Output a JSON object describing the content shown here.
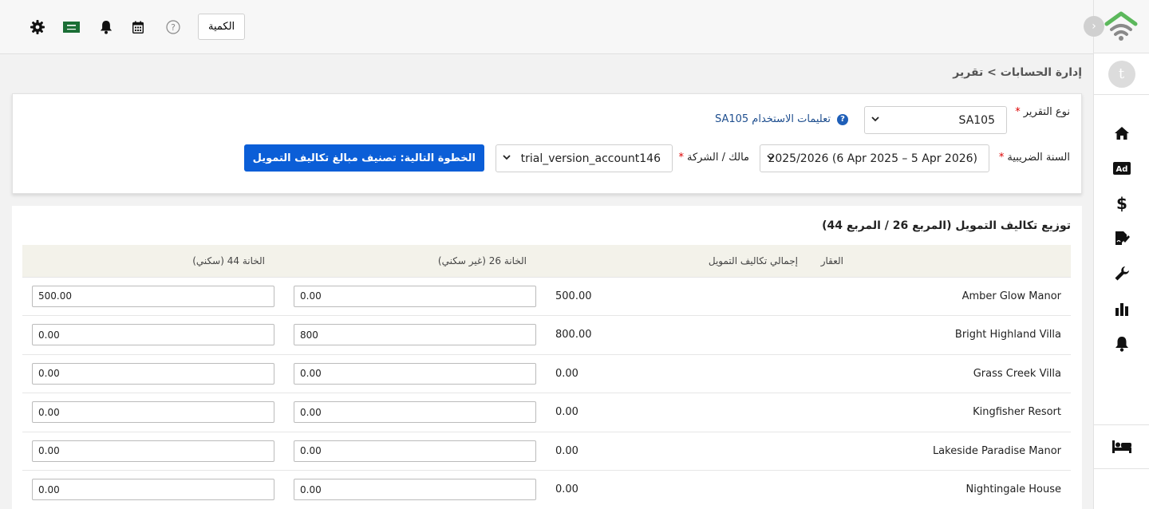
{
  "topbar": {
    "quantity_button": "الكمية",
    "icons": [
      "settings-gear-icon",
      "saudi-flag-icon",
      "bell-icon",
      "calendar-icon",
      "help-circle-icon"
    ]
  },
  "sidebar": {
    "avatar_letter": "t",
    "nav_icons": [
      "home-icon",
      "ad-icon",
      "dollar-icon",
      "signature-icon",
      "wrench-icon",
      "bar-chart-icon",
      "bell-icon"
    ],
    "bottom_icon": "bed-icon"
  },
  "breadcrumb": "إدارة الحسابات > تقرير",
  "filters": {
    "report_type_label": "نوع التقرير",
    "report_type_value": "SA105",
    "help_link": "تعليمات الاستخدام SA105",
    "tax_year_label": "السنة الضريبية",
    "tax_year_value": "2025/2026 (6 Apr 2025 – 5 Apr 2026)",
    "owner_label": "مالك / الشركة",
    "owner_value": "trial_version_account146",
    "next_button": "الخطوة التالية: تصنيف مبالغ تكاليف التمويل",
    "required_mark": "*"
  },
  "table": {
    "title": "توزيع تكاليف التمويل (المربع 26 / المربع 44)",
    "headers": {
      "property": "العقار",
      "total": "إجمالي تكاليف التمويل",
      "box26": "الخانة 26 (غير سكني)",
      "box44": "الخانة 44 (سكني)"
    },
    "rows": [
      {
        "property": "Amber Glow Manor",
        "total": "500.00",
        "box26": "0.00",
        "box44": "500.00"
      },
      {
        "property": "Bright Highland Villa",
        "total": "800.00",
        "box26": "800",
        "box44": "0.00"
      },
      {
        "property": "Grass Creek Villa",
        "total": "0.00",
        "box26": "0.00",
        "box44": "0.00"
      },
      {
        "property": "Kingfisher Resort",
        "total": "0.00",
        "box26": "0.00",
        "box44": "0.00"
      },
      {
        "property": "Lakeside Paradise Manor",
        "total": "0.00",
        "box26": "0.00",
        "box44": "0.00"
      },
      {
        "property": "Nightingale House",
        "total": "0.00",
        "box26": "0.00",
        "box44": "0.00"
      }
    ]
  },
  "colors": {
    "primary": "#0b5ed7",
    "logo_green": "#5cb85c",
    "logo_gray": "#8a8a8a",
    "header_bg": "#f3f2ea"
  }
}
